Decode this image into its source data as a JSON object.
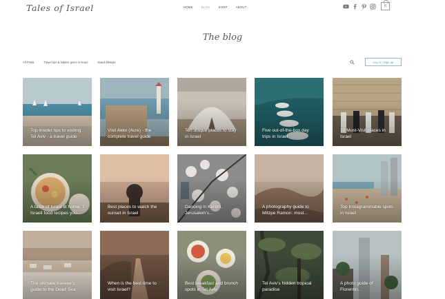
{
  "header": {
    "logo": "Tales of Israel",
    "nav": [
      "HOME",
      "BLOG",
      "SHOP",
      "ABOUT"
    ],
    "active_nav": "BLOG",
    "social_icons": [
      "youtube-icon",
      "facebook-icon",
      "pinterest-icon",
      "instagram-icon"
    ],
    "cart_count": "0"
  },
  "page_title": "The blog",
  "categories": [
    "All Posts",
    "Travel tips & hidden gems in Israel",
    "Israeli lifestyle"
  ],
  "login_label": "Log in / Sign up",
  "posts": [
    {
      "title": "Top insider tips to visiting Tel Aviv - a travel guide",
      "theme": "beach"
    },
    {
      "title": "Visit Akko (Acre) - the complete travel guide",
      "theme": "old-city"
    },
    {
      "title": "Ten unique places to stay in Israel",
      "theme": "tent"
    },
    {
      "title": "Five out-of-the-box day trips in Israel",
      "theme": "sea"
    },
    {
      "title": "10 Must-Visit places in Israel",
      "theme": "western-wall"
    },
    {
      "title": "A taste of Israel at home: 7 Israeli food recipes you...",
      "theme": "food"
    },
    {
      "title": "Best places to watch the sunset in Israel",
      "theme": "sunset"
    },
    {
      "title": "Dancing in Kerem, Jerusalem's...",
      "theme": "blossom"
    },
    {
      "title": "A photography guide to Mitzpe Ramon: most...",
      "theme": "desert"
    },
    {
      "title": "Top Instagrammable spots in Israel",
      "theme": "coast"
    },
    {
      "title": "The ultimate traveler's guide to the Dead Sea",
      "theme": "dead-sea"
    },
    {
      "title": "When is the best time to visit Israel?",
      "theme": "road"
    },
    {
      "title": "Best breakfast and brunch spots in Tel Aviv",
      "theme": "brunch"
    },
    {
      "title": "Tel Aviv's hidden tropical paradise",
      "theme": "jungle"
    },
    {
      "title": "A photo guide of Florentin...",
      "theme": "tower"
    }
  ]
}
